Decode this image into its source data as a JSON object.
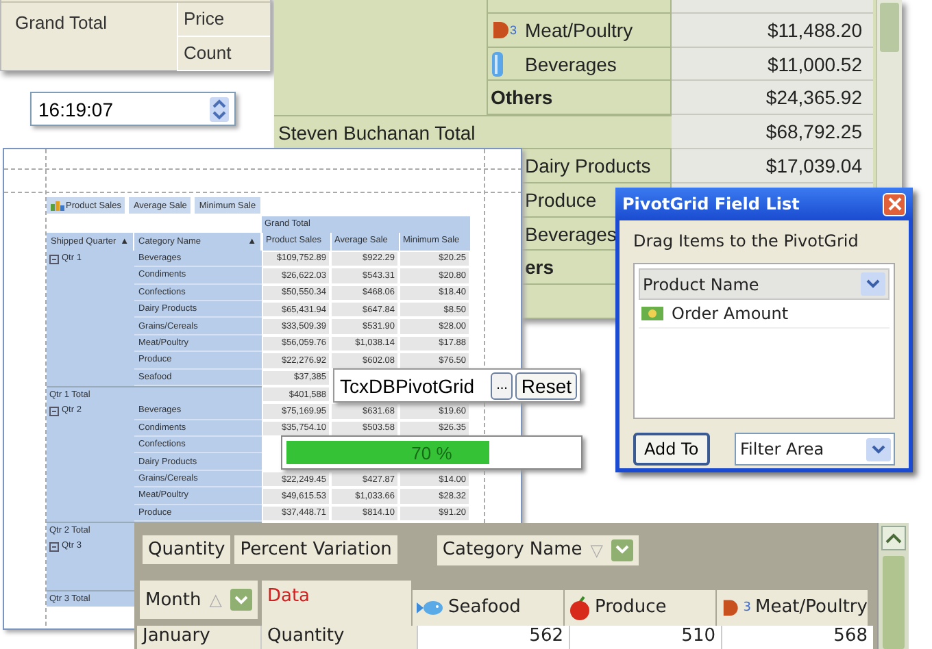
{
  "grand_total_panel": {
    "label": "Grand Total",
    "measures": [
      "Price",
      "Count"
    ]
  },
  "time_editor": {
    "value": "16:19:07"
  },
  "employee_pivot": {
    "rows": [
      {
        "kind": "meat",
        "icon_badge": "3",
        "category": "Meat/Poultry",
        "value": "$11,488.20"
      },
      {
        "kind": "beverage",
        "category": "Beverages",
        "value": "$11,000.52"
      },
      {
        "kind": "others",
        "category": "Others",
        "value": "$24,365.92"
      },
      {
        "kind": "total",
        "category": "Steven Buchanan Total",
        "value": "$68,792.25"
      },
      {
        "kind": "item",
        "category": "Dairy Products",
        "value": "$17,039.04"
      },
      {
        "kind": "item",
        "category": "Produce"
      },
      {
        "kind": "item",
        "category": "Beverages"
      },
      {
        "kind": "others-cut",
        "category": "ers"
      },
      {
        "kind": "blank"
      }
    ]
  },
  "report": {
    "data_fields": [
      "Product Sales",
      "Average Sale",
      "Minimum Sale"
    ],
    "grand_total": "Grand Total",
    "row_fields": [
      {
        "label": "Shipped Quarter",
        "sort": "▲"
      },
      {
        "label": "Category Name",
        "sort": "▲"
      }
    ],
    "columns": [
      "Product Sales",
      "Average Sale",
      "Minimum Sale"
    ],
    "groups": [
      {
        "label": "Qtr 1",
        "expanded": true,
        "total_label": "Qtr 1 Total",
        "total_values": [
          "$401,588"
        ],
        "rows": [
          {
            "category": "Beverages",
            "values": [
              "$109,752.89",
              "$922.29",
              "$20.25"
            ]
          },
          {
            "category": "Condiments",
            "values": [
              "$26,622.03",
              "$543.31",
              "$20.80"
            ]
          },
          {
            "category": "Confections",
            "values": [
              "$50,550.34",
              "$468.06",
              "$18.40"
            ]
          },
          {
            "category": "Dairy Products",
            "values": [
              "$65,431.94",
              "$647.84",
              "$8.50"
            ]
          },
          {
            "category": "Grains/Cereals",
            "values": [
              "$33,509.39",
              "$531.90",
              "$28.00"
            ]
          },
          {
            "category": "Meat/Poultry",
            "values": [
              "$56,059.76",
              "$1,038.14",
              "$17.88"
            ]
          },
          {
            "category": "Produce",
            "values": [
              "$22,276.92",
              "$602.08",
              "$76.50"
            ]
          },
          {
            "category": "Seafood",
            "values": [
              "$37,385"
            ]
          }
        ]
      },
      {
        "label": "Qtr 2",
        "expanded": true,
        "total_label": "Qtr 2 Total",
        "rows": [
          {
            "category": "Beverages",
            "values": [
              "$75,169.95",
              "$631.68",
              "$19.60"
            ]
          },
          {
            "category": "Condiments",
            "values": [
              "$35,754.10",
              "$503.58",
              "$26.35"
            ]
          },
          {
            "category": "Confections"
          },
          {
            "category": "Dairy Products"
          },
          {
            "category": "Grains/Cereals",
            "values": [
              "$22,249.45",
              "$427.87",
              "$14.00"
            ]
          },
          {
            "category": "Meat/Poultry",
            "values": [
              "$49,615.53",
              "$1,033.66",
              "$28.32"
            ]
          },
          {
            "category": "Produce",
            "values": [
              "$37,448.71",
              "$814.10",
              "$91.20"
            ]
          }
        ]
      },
      {
        "label": "Qtr 3",
        "expanded": true,
        "total_label": "Qtr 3 Total"
      }
    ]
  },
  "grid_control": {
    "name": "TcxDBPivotGrid",
    "ellipsis": "...",
    "reset": "Reset"
  },
  "progress": {
    "level": 0.7,
    "label": "70 %"
  },
  "field_list": {
    "title": "PivotGrid Field List",
    "hint": "Drag Items to the PivotGrid",
    "list_header": "Product Name",
    "items": [
      "Order Amount"
    ],
    "add_button": "Add To",
    "area": "Filter Area"
  },
  "olap_grid": {
    "data_fields": [
      "Quantity",
      "Percent Variation"
    ],
    "column_field": {
      "label": "Category Name",
      "sort": "▽"
    },
    "row_field": {
      "label": "Month",
      "sort": "△"
    },
    "data_header": "Data",
    "columns": [
      {
        "kind": "fish",
        "label": "Seafood"
      },
      {
        "kind": "apple",
        "label": "Produce"
      },
      {
        "kind": "meat",
        "badge": "3",
        "label": "Meat/Poultry"
      }
    ],
    "rows": [
      {
        "month": "January",
        "measure": "Quantity",
        "values": [
          "562",
          "510",
          "568"
        ]
      }
    ]
  }
}
